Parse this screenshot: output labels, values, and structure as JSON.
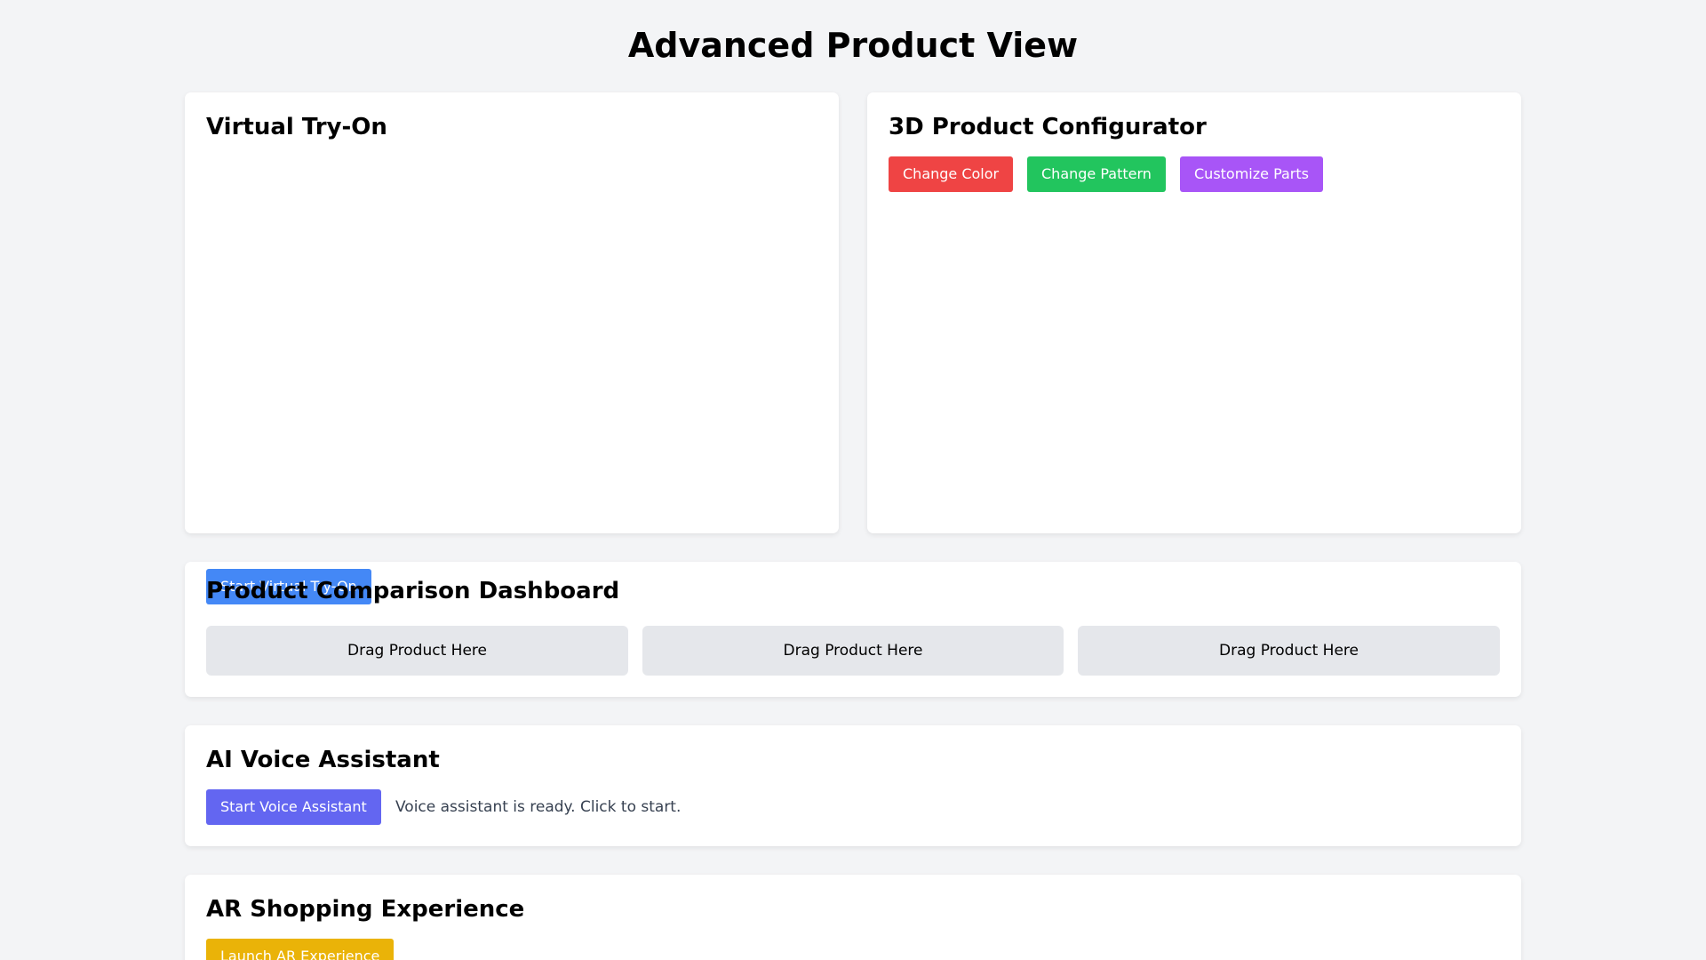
{
  "page": {
    "title": "Advanced Product View"
  },
  "virtual_try_on": {
    "title": "Virtual Try-On",
    "start_button": "Start Virtual Try-On"
  },
  "configurator": {
    "title": "3D Product Configurator",
    "buttons": {
      "change_color": "Change Color",
      "change_pattern": "Change Pattern",
      "customize_parts": "Customize Parts"
    }
  },
  "comparison": {
    "title": "Product Comparison Dashboard",
    "slots": [
      "Drag Product Here",
      "Drag Product Here",
      "Drag Product Here"
    ]
  },
  "voice_assistant": {
    "title": "AI Voice Assistant",
    "start_button": "Start Voice Assistant",
    "status": "Voice assistant is ready. Click to start."
  },
  "ar": {
    "title": "AR Shopping Experience",
    "launch_button": "Launch AR Experience"
  },
  "colors": {
    "background": "#f3f4f6",
    "blue": "#3b82f6",
    "red": "#ef4444",
    "green": "#22c55e",
    "purple": "#a855f7",
    "indigo": "#6366f1",
    "yellow": "#eab308"
  }
}
